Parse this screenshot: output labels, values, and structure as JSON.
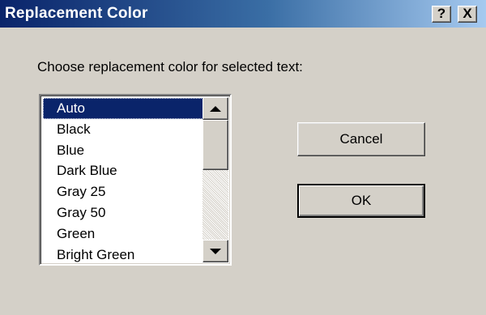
{
  "window": {
    "title": "Replacement Color",
    "help_label": "?",
    "close_label": "X"
  },
  "dialog": {
    "prompt": "Choose replacement color for selected text:"
  },
  "listbox": {
    "selected": "Auto",
    "items": [
      {
        "label": "Auto",
        "selected": true
      },
      {
        "label": "Black"
      },
      {
        "label": "Blue"
      },
      {
        "label": "Dark Blue"
      },
      {
        "label": "Gray 25"
      },
      {
        "label": "Gray 50"
      },
      {
        "label": "Green"
      },
      {
        "label": "Bright Green"
      }
    ]
  },
  "buttons": {
    "cancel": "Cancel",
    "ok": "OK"
  },
  "colors": {
    "title_gradient_start": "#0a246a",
    "title_gradient_end": "#a6caf0",
    "dialog_bg": "#d4d0c8",
    "selection_bg": "#0a246a"
  },
  "icons": {
    "scroll_up": "arrow-up-icon",
    "scroll_down": "arrow-down-icon"
  }
}
